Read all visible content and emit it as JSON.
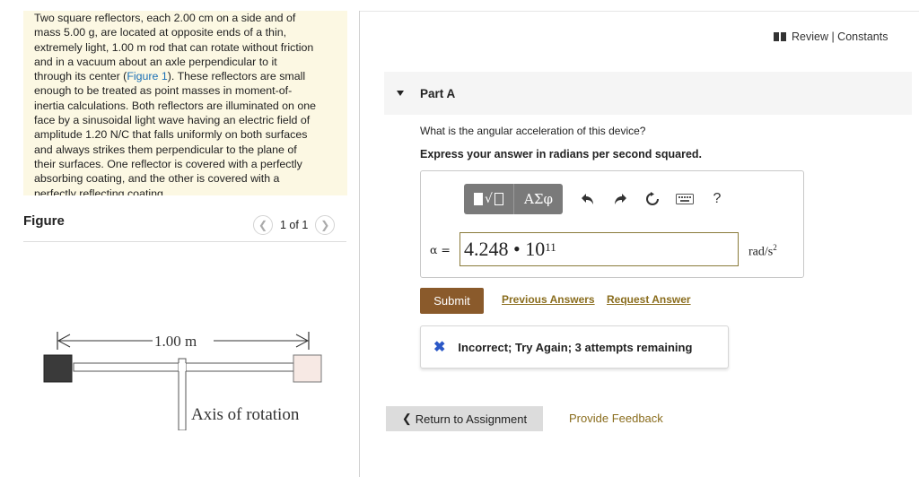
{
  "problem": {
    "lines": [
      "Two square reflectors, each 2.00 cm on a side and of",
      "mass 5.00 g, are located at opposite ends of a thin,",
      "extremely light, 1.00 m rod that can rotate without friction",
      "and in a vacuum about an axle perpendicular to it",
      "through its center (",
      "). These reflectors are small",
      "enough to be treated as point masses in moment-of-",
      "inertia calculations. Both reflectors are illuminated on one",
      "face by a sinusoidal light wave having an electric field of",
      "amplitude 1.20 N/C that falls uniformly on both surfaces",
      "and always strikes them perpendicular to the plane of",
      "their surfaces. One reflector is covered with a perfectly",
      "absorbing coating, and the other is covered with a",
      "perfectly reflecting coating."
    ],
    "figure_link": "Figure 1"
  },
  "figure": {
    "label": "Figure",
    "pager": "1 of 1",
    "length_label": "1.00 m",
    "axis_label": "Axis of rotation"
  },
  "header": {
    "review_constants": "Review | Constants"
  },
  "part": {
    "title": "Part A",
    "question": "What is the angular acceleration of this device?",
    "instruction": "Express your answer in radians per second squared."
  },
  "toolbar": {
    "greek_label": "ΑΣφ",
    "help_label": "?"
  },
  "answer": {
    "variable": "α =",
    "mantissa": "4.248 • 10",
    "exponent": "11",
    "units_base": "rad/s",
    "units_exp": "2"
  },
  "actions": {
    "submit": "Submit",
    "previous_answers": "Previous Answers",
    "request_answer": "Request Answer"
  },
  "feedback": {
    "message": "Incorrect; Try Again; 3 attempts remaining"
  },
  "footer": {
    "return": "Return to Assignment",
    "provide_feedback": "Provide Feedback"
  },
  "colors": {
    "problem_bg": "#fcf8e3",
    "submit_bg": "#8a5a2b",
    "link": "#8a6d1e",
    "incorrect_icon": "#2b58c7"
  }
}
